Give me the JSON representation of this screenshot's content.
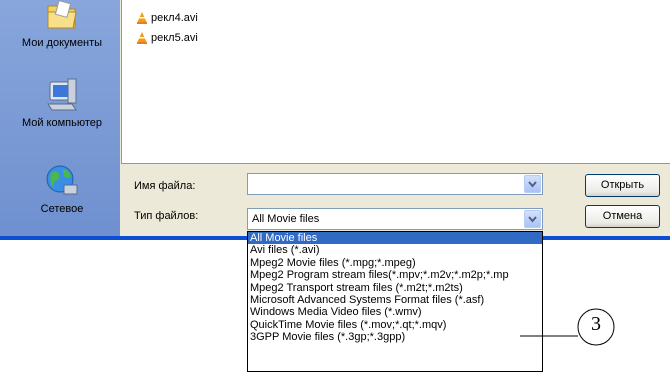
{
  "places": [
    {
      "label": "Мои документы",
      "icon": "my-documents-icon"
    },
    {
      "label": "Мой компьютер",
      "icon": "my-computer-icon"
    },
    {
      "label": "Сетевое",
      "icon": "network-icon"
    }
  ],
  "files": [
    {
      "name": "рекл4.avi",
      "icon": "vlc-icon"
    },
    {
      "name": "рекл5.avi",
      "icon": "vlc-icon"
    }
  ],
  "form": {
    "filename_label": "Имя файла:",
    "filename_value": "",
    "filetype_label": "Тип файлов:",
    "filetype_value": "All Movie files"
  },
  "buttons": {
    "open": "Открыть",
    "cancel": "Отмена"
  },
  "filetype_options": [
    "All Movie files",
    "Avi files (*.avi)",
    "Mpeg2 Movie files (*.mpg;*.mpeg)",
    "Mpeg2 Program stream files(*.mpv;*.m2v;*.m2p;*.mp",
    "Mpeg2 Transport stream files (*.m2t;*.m2ts)",
    "Microsoft Advanced Systems Format files (*.asf)",
    "Windows Media Video files (*.wmv)",
    "QuickTime Movie files (*.mov;*.qt;*.mqv)",
    "3GPP Movie files (*.3gp;*.3gpp)"
  ],
  "selected_option_index": 0,
  "callout": {
    "number": "3"
  },
  "colors": {
    "selection": "#316ac5",
    "dialog_bg": "#ece9d8",
    "places_bar": "#7e9fd8",
    "xp_border": "#0c4fd2"
  }
}
